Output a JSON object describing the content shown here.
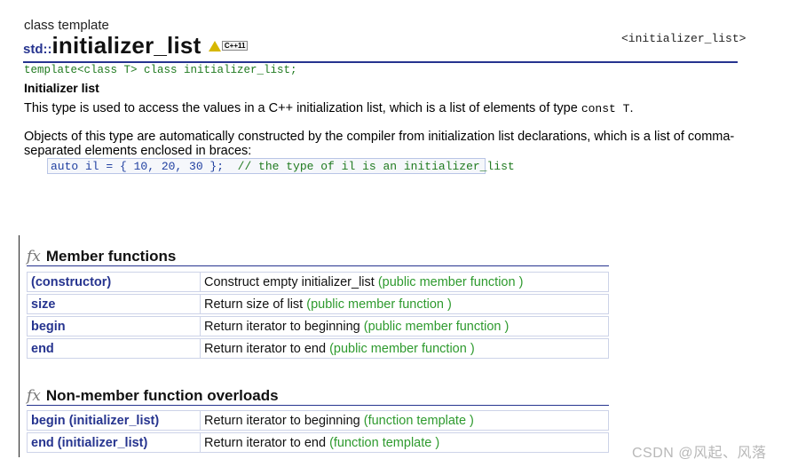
{
  "header": {
    "kicker": "class template",
    "namespace": "std::",
    "title": "initializer_list",
    "badge_text": "C++11",
    "header_include": "<initializer_list>",
    "declaration": "template<class T> class initializer_list;"
  },
  "intro": {
    "section_title": "Initializer list",
    "desc1_prefix": "This type is used to access the values in a C++ initialization list, which is a list of elements of type ",
    "desc1_code": "const T",
    "desc1_suffix": ".",
    "desc2": "Objects of this type are automatically constructed by the compiler from initialization list declarations, which is a list of comma-separated elements enclosed in braces:",
    "code_line": "auto il = { 10, 20, 30 };  ",
    "code_comment": "// the type of il is an initializer_list"
  },
  "member_functions": {
    "fx_symbol": "fx",
    "heading": "Member functions",
    "rows": [
      {
        "name": "(constructor)",
        "desc": "Construct empty initializer_list",
        "kind": "(public member function )"
      },
      {
        "name": "size",
        "desc": "Return size of list",
        "kind": "(public member function )"
      },
      {
        "name": "begin",
        "desc": "Return iterator to beginning",
        "kind": "(public member function )"
      },
      {
        "name": "end",
        "desc": "Return iterator to end",
        "kind": "(public member function )"
      }
    ]
  },
  "non_member": {
    "fx_symbol": "fx",
    "heading": "Non-member function overloads",
    "rows": [
      {
        "name": "begin (initializer_list)",
        "desc": "Return iterator to beginning",
        "kind": "(function template )"
      },
      {
        "name": "end (initializer_list)",
        "desc": "Return iterator to end",
        "kind": "(function template )"
      }
    ]
  },
  "watermark": "CSDN @风起、风落",
  "colors": {
    "link_blue": "#26348f",
    "kind_green": "#2e9a2e",
    "decl_green": "#1f7a1f"
  }
}
